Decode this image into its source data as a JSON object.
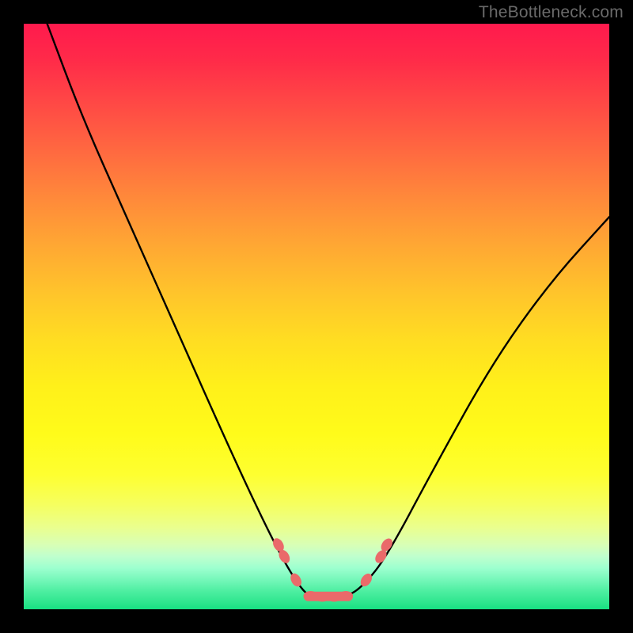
{
  "watermark": "TheBottleneck.com",
  "chart_data": {
    "type": "line",
    "title": "",
    "xlabel": "",
    "ylabel": "",
    "xlim": [
      0,
      100
    ],
    "ylim": [
      0,
      100
    ],
    "series": [
      {
        "name": "curve",
        "x": [
          4,
          10,
          18,
          26,
          34,
          40,
          44,
          47,
          49,
          52,
          55,
          58,
          62,
          70,
          80,
          90,
          100
        ],
        "y": [
          100,
          84,
          66,
          48,
          30,
          17,
          9,
          4,
          2,
          2,
          2,
          4,
          9,
          24,
          42,
          56,
          67
        ]
      }
    ],
    "markers": [
      {
        "name": "left-cluster-1",
        "x": 43.5,
        "y": 11
      },
      {
        "name": "left-cluster-2",
        "x": 44.5,
        "y": 9
      },
      {
        "name": "left-cluster-3",
        "x": 46.5,
        "y": 5
      },
      {
        "name": "flat-1",
        "x": 49,
        "y": 2.3
      },
      {
        "name": "flat-2",
        "x": 51,
        "y": 2.1
      },
      {
        "name": "flat-3",
        "x": 53,
        "y": 2.1
      },
      {
        "name": "flat-4",
        "x": 55,
        "y": 2.3
      },
      {
        "name": "right-cluster-1",
        "x": 58.5,
        "y": 5
      },
      {
        "name": "right-cluster-2",
        "x": 61,
        "y": 9
      },
      {
        "name": "right-cluster-3",
        "x": 62,
        "y": 11
      }
    ],
    "marker_color": "#ea6a6a",
    "curve_color": "#000000"
  }
}
